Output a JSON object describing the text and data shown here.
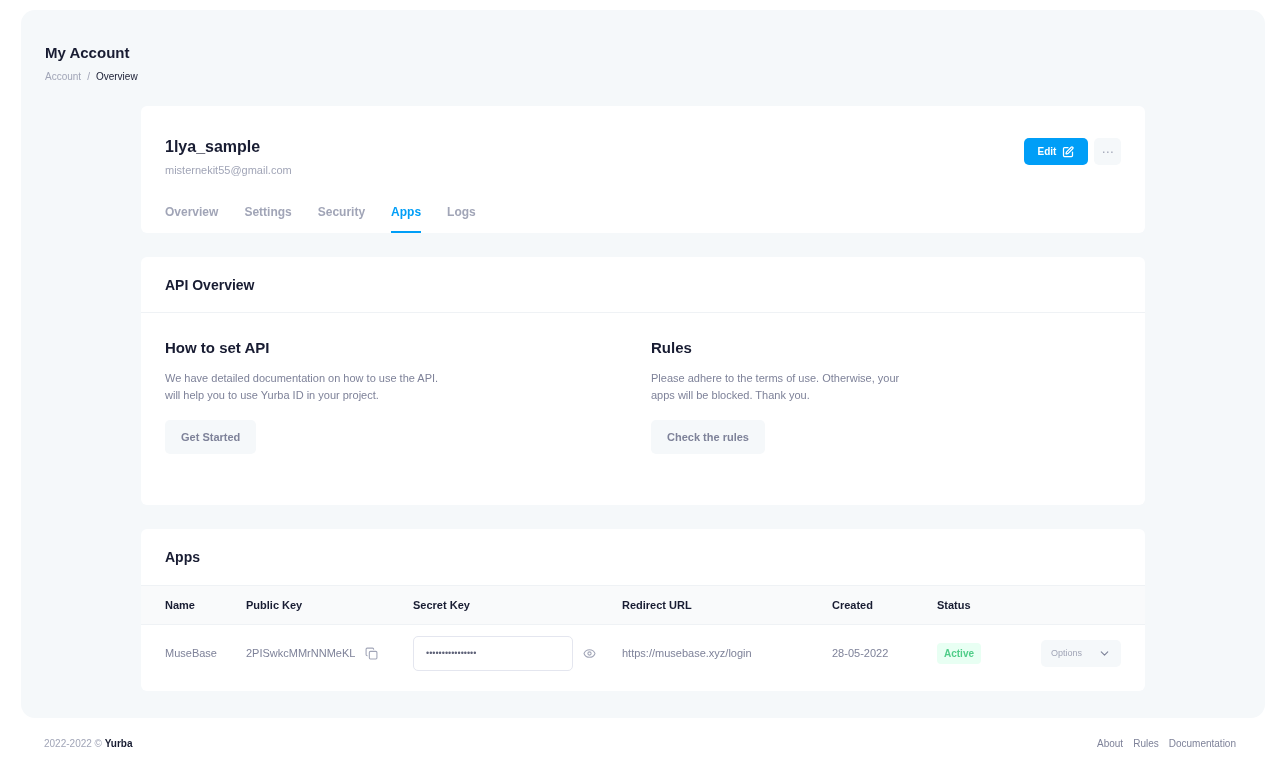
{
  "page": {
    "title": "My Account",
    "breadcrumb_separator": "/",
    "breadcrumb": [
      {
        "label": "Account",
        "current": false
      },
      {
        "label": "Overview",
        "current": true
      }
    ]
  },
  "profile": {
    "username": "1lya_sample",
    "email": "misternekit55@gmail.com",
    "edit_button": "Edit",
    "more_button": "⋯",
    "tabs": [
      {
        "label": "Overview",
        "selected": false
      },
      {
        "label": "Settings",
        "selected": false
      },
      {
        "label": "Security",
        "selected": false
      },
      {
        "label": "Apps",
        "selected": true
      },
      {
        "label": "Logs",
        "selected": false
      }
    ]
  },
  "api_overview": {
    "title": "API Overview",
    "sections": [
      {
        "heading": "How to set API",
        "lines": [
          "We have detailed documentation on how to use the API.",
          "will help you to use Yurba ID in your project."
        ],
        "button": "Get Started"
      },
      {
        "heading": "Rules",
        "lines": [
          "Please adhere to the terms of use. Otherwise, your",
          "apps will be blocked. Thank you."
        ],
        "button": "Check the rules"
      }
    ]
  },
  "apps": {
    "title": "Apps",
    "columns": [
      "Name",
      "Public Key",
      "Secret Key",
      "Redirect URL",
      "Created",
      "Status"
    ],
    "rows": [
      {
        "name": "MuseBase",
        "public_key": "2PISwkcMMrNNMeKL",
        "secret_key": "••••••••••••••••",
        "redirect_url": "https://musebase.xyz/login",
        "created": "28-05-2022",
        "status": {
          "label": "Active",
          "kind": "active"
        },
        "options": "Options"
      }
    ]
  },
  "footer": {
    "copyright": "2022-2022 © **Yurba**",
    "links": [
      "About",
      "Rules",
      "Documentation"
    ]
  }
}
